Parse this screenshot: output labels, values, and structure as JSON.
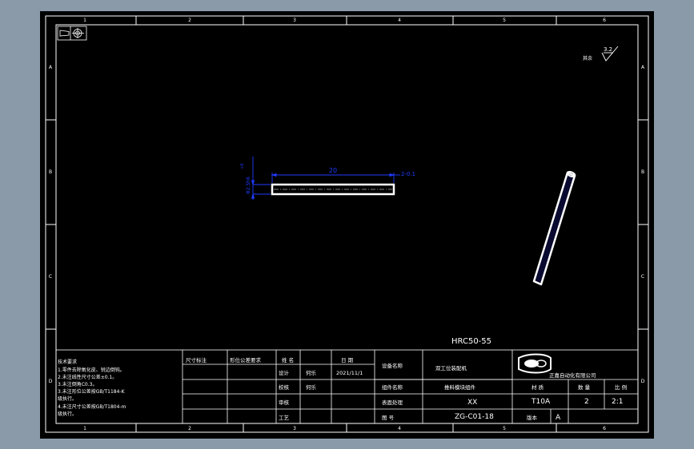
{
  "colors": {
    "viewport_bg": "#8a9aa9",
    "sheet": "#000000",
    "line": "#ffffff",
    "dimension": "#1f3cff"
  },
  "frame": {
    "column_numbers": [
      "1",
      "2",
      "3",
      "4",
      "5",
      "6"
    ],
    "row_letters": [
      "A",
      "B",
      "C",
      "D"
    ]
  },
  "drawing": {
    "dimension_length": "20",
    "dimension_tolerance": "2-0.1",
    "dimension_diameter": "Φ2.5h6",
    "dimension_side": "+0",
    "surface_roughness_value": "3.2",
    "surface_roughness_note": "其余",
    "hardness_note": "HRC50-55",
    "projection_symbol": "first-angle-projection-icon"
  },
  "title_block": {
    "tech_req_title": "技术要求",
    "tech_req_lines": [
      "1.零件去除氧化皮、锐边倒钝。",
      "2.未注线性尺寸公差±0.1。",
      "3.未注倒角C0.3。",
      "3.未注形位公差按GB/T1184-K",
      "  级执行。",
      "4.未注尺寸公差按GB/T1804-m",
      "  级执行。"
    ],
    "col_dimension": "尺寸标注",
    "col_precision": "形位公差要求",
    "col_name": "姓 名",
    "col_date": "日 期",
    "row_design": "设计",
    "row_check": "校核",
    "row_review": "审核",
    "row_process": "工艺",
    "designer": "何乐",
    "checker": "何乐",
    "date": "2021/11/1",
    "equipment_name_label": "设备名称",
    "equipment_name": "双工位装配机",
    "assembly_label": "组件名称",
    "assembly_name": "推料模块组件",
    "surface_label": "表面处理",
    "surface_value": "XX",
    "drawing_no_label": "图 号",
    "drawing_no": "ZG-C01-18",
    "company_name": "正嘉自动化有限公司",
    "company_logo": "company-logo-icon",
    "material_label": "材 质",
    "material": "T10A",
    "quantity_label": "数 量",
    "quantity": "2",
    "scale_label": "比 例",
    "scale": "2:1",
    "version_label": "版本",
    "version": "A"
  }
}
